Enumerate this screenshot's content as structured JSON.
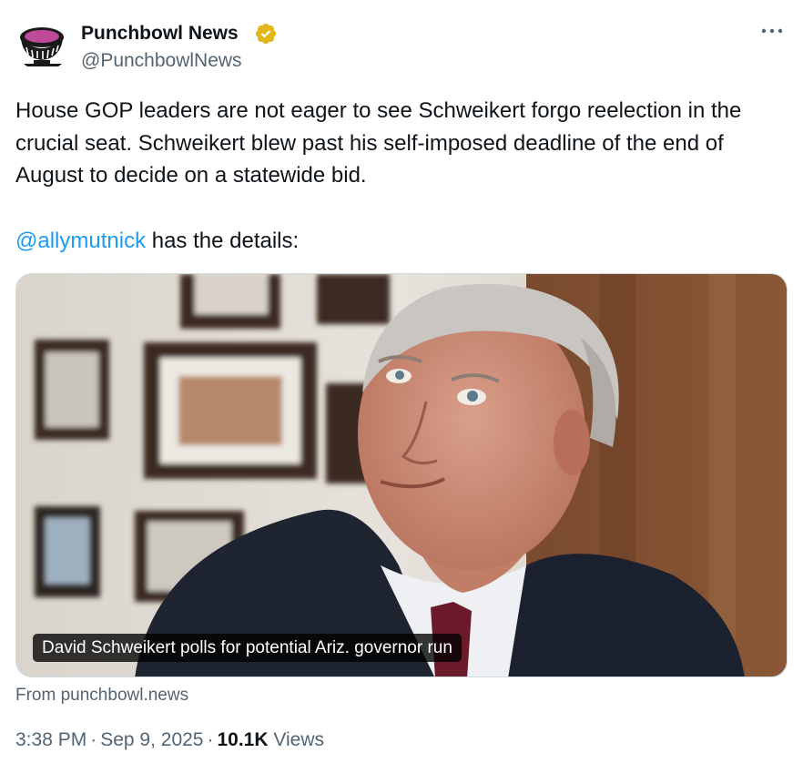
{
  "author": {
    "name": "Punchbowl News",
    "handle": "@PunchbowlNews",
    "verified_badge_color": "#e2b719"
  },
  "tweet": {
    "text_line1": "House GOP leaders are not eager to see Schweikert forgo reelection in the crucial seat. Schweikert blew past his self-imposed deadline of the end of August to decide on a statewide bid.",
    "mention": "@allymutnick",
    "text_after_mention": " has the details:"
  },
  "card": {
    "caption": "David Schweikert polls for potential Ariz. governor run",
    "source": "From punchbowl.news"
  },
  "meta": {
    "time": "3:38 PM",
    "separator": "·",
    "date": "Sep 9, 2025",
    "views_count": "10.1K",
    "views_label": "Views"
  },
  "icons": {
    "avatar": "punch-bowl-logo-icon",
    "verified": "verified-badge-icon",
    "more": "more-options-icon"
  },
  "colors": {
    "link": "#1d9bf0",
    "secondary_text": "#536471",
    "primary_text": "#0f1419"
  }
}
